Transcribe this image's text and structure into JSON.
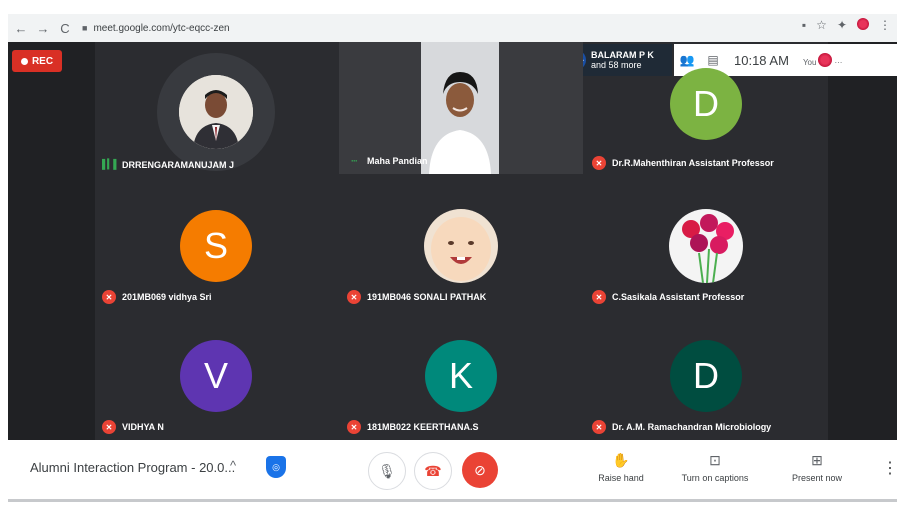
{
  "browser": {
    "url": "meet.google.com/ytc-eqcc-zen",
    "back_icon": "←",
    "forward_icon": "→",
    "reload_icon": "C",
    "lock_icon": "🔒"
  },
  "meeting": {
    "rec_label": "REC",
    "people_chip": {
      "avatar_text": "BALA",
      "name": "BALARAM P K",
      "more": "and 58 more"
    },
    "time": "10:18 AM",
    "you_label": "You"
  },
  "participants": [
    {
      "name": "DRRENGARAMANUJAM J",
      "type": "photo-man",
      "status": "speaking"
    },
    {
      "name": "Maha Pandian",
      "type": "video",
      "status": "speaking"
    },
    {
      "name": "Dr.R.Mahenthiran Assistant Professor",
      "initial": "D",
      "color": "#7cb342",
      "status": "muted"
    },
    {
      "name": "201MB069 vidhya Sri",
      "initial": "S",
      "color": "#f57c00",
      "status": "muted"
    },
    {
      "name": "191MB046 SONALI PATHAK",
      "type": "photo-baby",
      "status": "muted"
    },
    {
      "name": "C.Sasikala Assistant Professor",
      "type": "photo-flowers",
      "status": "muted"
    },
    {
      "name": "VIDHYA N",
      "initial": "V",
      "color": "#5e35b1",
      "status": "muted"
    },
    {
      "name": "181MB022 KEERTHANA.S",
      "initial": "K",
      "color": "#00897b",
      "status": "muted"
    },
    {
      "name": "Dr. A.M. Ramachandran Microbiology",
      "initial": "D",
      "color": "#004d40",
      "status": "muted"
    }
  ],
  "bottom": {
    "meeting_title": "Alumni Interaction Program - 20.0...",
    "raise_hand": "Raise hand",
    "captions": "Turn on captions",
    "present": "Present now"
  }
}
